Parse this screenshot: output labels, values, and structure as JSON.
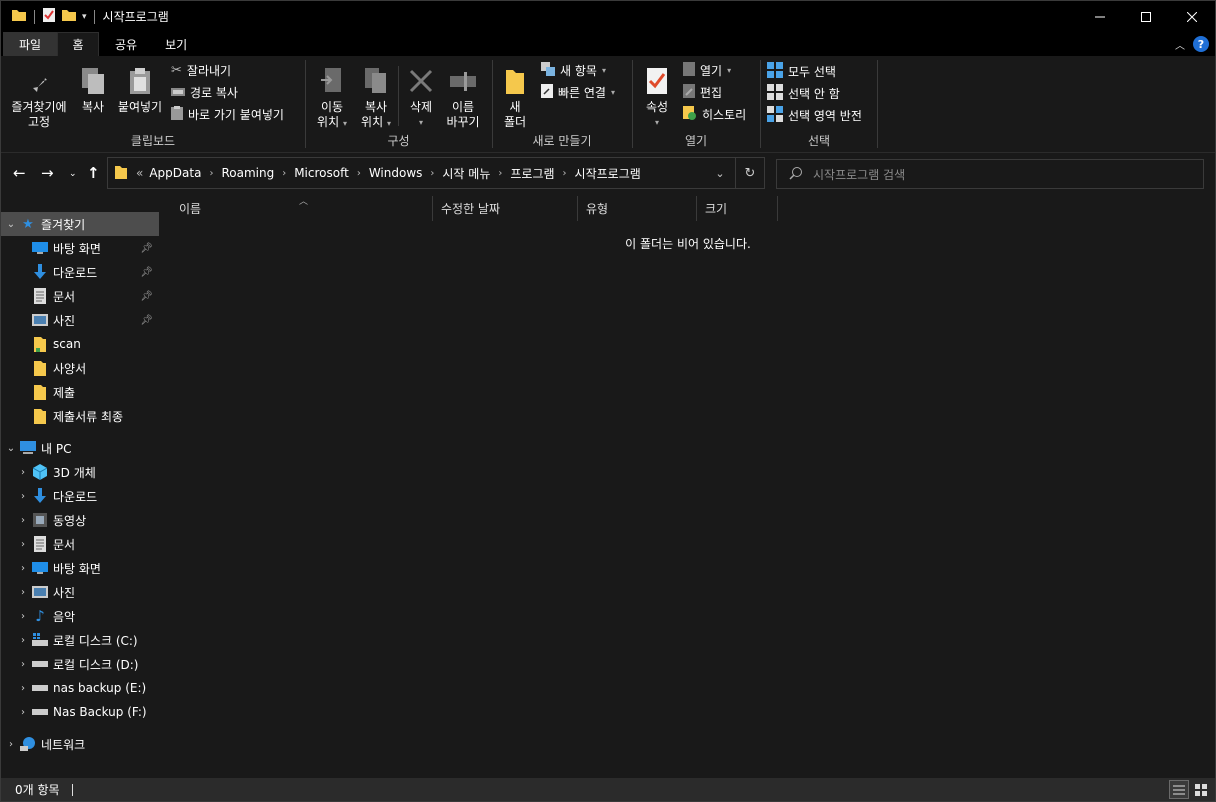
{
  "window": {
    "title": "시작프로그램"
  },
  "ribbon_tabs": {
    "file": "파일",
    "home": "홈",
    "share": "공유",
    "view": "보기"
  },
  "clipboard": {
    "pin_label_1": "즐겨찾기에",
    "pin_label_2": "고정",
    "copy": "복사",
    "paste": "붙여넣기",
    "cut": "잘라내기",
    "copy_path": "경로 복사",
    "paste_shortcut": "바로 가기 붙여넣기",
    "group_label": "클립보드"
  },
  "organize": {
    "move_1": "이동",
    "move_2": "위치",
    "copyto_1": "복사",
    "copyto_2": "위치",
    "delete": "삭제",
    "rename_1": "이름",
    "rename_2": "바꾸기",
    "group_label": "구성"
  },
  "new": {
    "new_folder_1": "새",
    "new_folder_2": "폴더",
    "new_item": "새 항목",
    "easy_access": "빠른 연결",
    "group_label": "새로 만들기"
  },
  "open": {
    "properties": "속성",
    "open": "열기",
    "edit": "편집",
    "history": "히스토리",
    "group_label": "열기"
  },
  "select": {
    "select_all": "모두 선택",
    "select_none": "선택 안 함",
    "invert": "선택 영역 반전",
    "group_label": "선택"
  },
  "address": {
    "overflow": "«",
    "segments": [
      "AppData",
      "Roaming",
      "Microsoft",
      "Windows",
      "시작 메뉴",
      "프로그램",
      "시작프로그램"
    ]
  },
  "search": {
    "placeholder": "시작프로그램 검색"
  },
  "nav": {
    "quick_access": "즐겨찾기",
    "quick_items": [
      "바탕 화면",
      "다운로드",
      "문서",
      "사진",
      "scan",
      "사양서",
      "제출",
      "제출서류 최종"
    ],
    "this_pc": "내 PC",
    "pc_items": [
      "3D 개체",
      "다운로드",
      "동영상",
      "문서",
      "바탕 화면",
      "사진",
      "음악",
      "로컬 디스크 (C:)",
      "로컬 디스크 (D:)",
      "nas backup (E:)",
      "Nas Backup (F:)"
    ],
    "network": "네트워크"
  },
  "columns": {
    "name": "이름",
    "modified": "수정한 날짜",
    "type": "유형",
    "size": "크기"
  },
  "content": {
    "empty_message": "이 폴더는 비어 있습니다."
  },
  "status": {
    "item_count": "0개 항목"
  },
  "colors": {
    "background": "#191919",
    "titlebar": "#000000",
    "selected": "#4d4d4d",
    "folder": "#f5c84c",
    "accent_blue": "#1f8ee8"
  }
}
